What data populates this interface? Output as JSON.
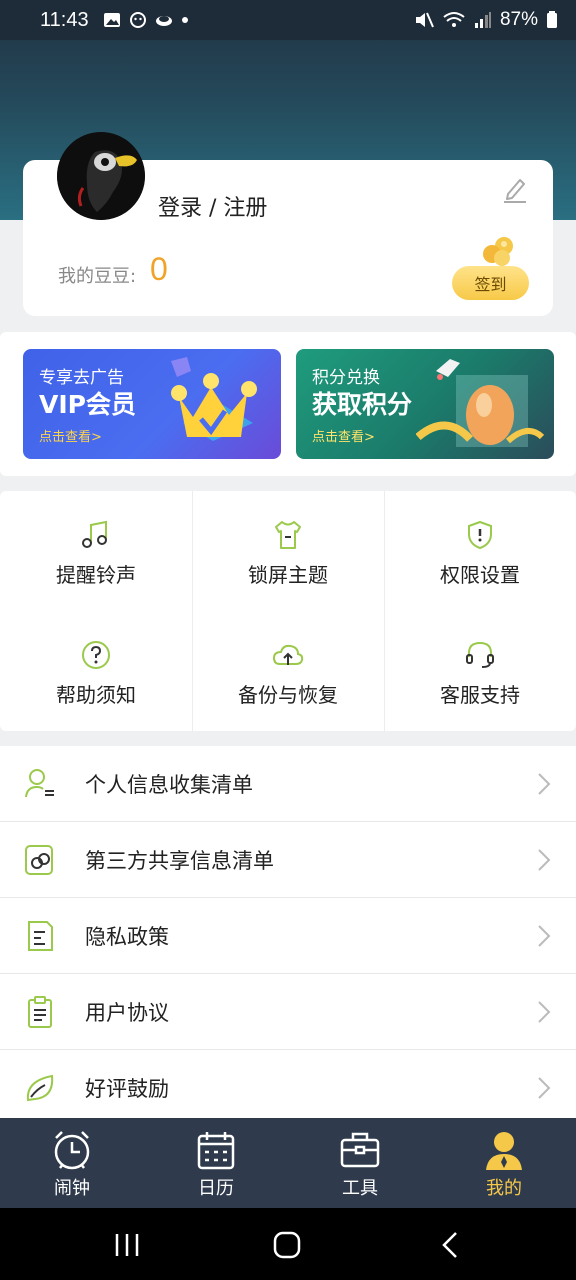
{
  "status_bar": {
    "time": "11:43",
    "battery": "87%",
    "left_icons": [
      "gallery-icon",
      "alarm-app-icon",
      "cloud-app-icon",
      "dot-icon"
    ],
    "right_icons": [
      "mute-icon",
      "wifi-icon",
      "signal-icon",
      "battery-icon"
    ]
  },
  "profile": {
    "login_label": "登录 / 注册",
    "beans_label": "我的豆豆:",
    "beans_value": "0",
    "checkin_label": "签到"
  },
  "banners": [
    {
      "sub": "专享去广告",
      "title": "VIP会员",
      "cta": "点击查看>"
    },
    {
      "sub": "积分兑换",
      "title": "获取积分",
      "cta": "点击查看>"
    }
  ],
  "grid": [
    {
      "label": "提醒铃声",
      "icon": "music-note-icon"
    },
    {
      "label": "锁屏主题",
      "icon": "tshirt-icon"
    },
    {
      "label": "权限设置",
      "icon": "shield-icon"
    },
    {
      "label": "帮助须知",
      "icon": "help-icon"
    },
    {
      "label": "备份与恢复",
      "icon": "cloud-upload-icon"
    },
    {
      "label": "客服支持",
      "icon": "headset-icon"
    }
  ],
  "list": [
    {
      "label": "个人信息收集清单",
      "icon": "user-list-icon"
    },
    {
      "label": "第三方共享信息清单",
      "icon": "share-link-icon"
    },
    {
      "label": "隐私政策",
      "icon": "document-icon"
    },
    {
      "label": "用户协议",
      "icon": "clipboard-icon"
    },
    {
      "label": "好评鼓励",
      "icon": "leaf-icon"
    }
  ],
  "nav": [
    {
      "label": "闹钟",
      "icon": "alarm-clock-icon",
      "active": false
    },
    {
      "label": "日历",
      "icon": "calendar-icon",
      "active": false
    },
    {
      "label": "工具",
      "icon": "toolbox-icon",
      "active": false
    },
    {
      "label": "我的",
      "icon": "profile-icon",
      "active": true
    }
  ],
  "colors": {
    "accent_yellow": "#f6c84a",
    "beans_orange": "#f0a328",
    "icon_green": "#9bc94b",
    "nav_bg": "#2f3b4c"
  }
}
